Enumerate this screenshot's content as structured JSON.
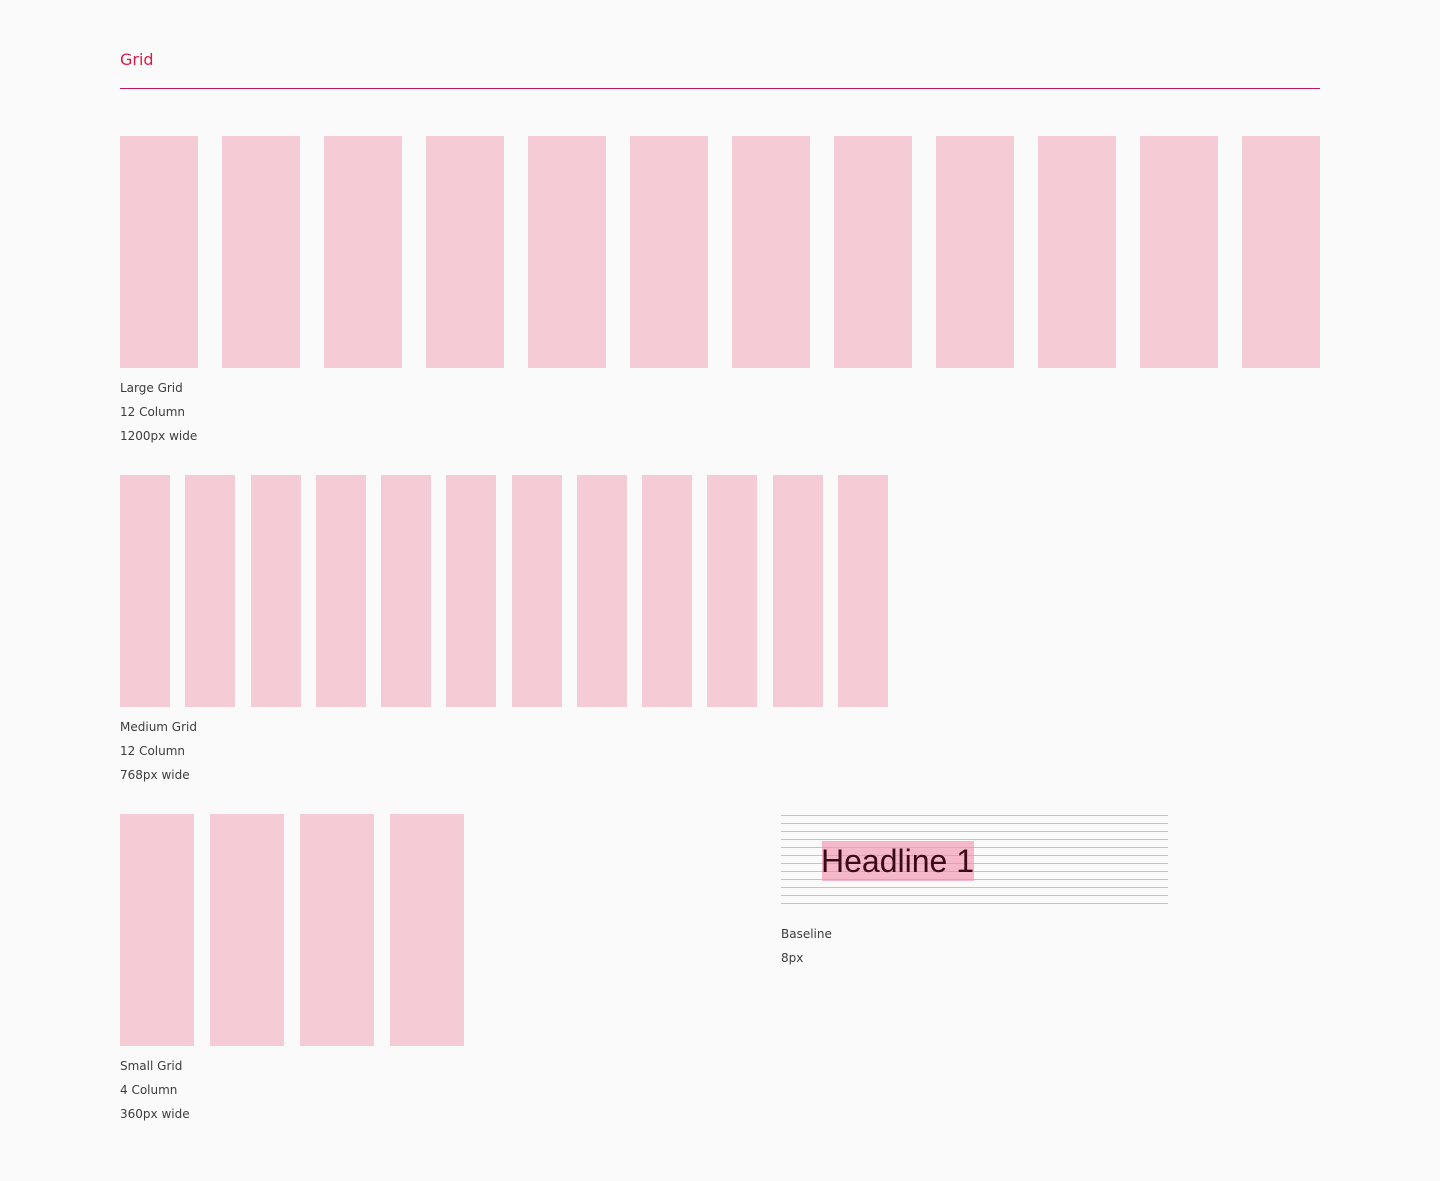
{
  "section_title": "Grid",
  "colors": {
    "accent": "#d81b49",
    "rule": "#c2185b",
    "column": "#f5ccd6",
    "baseline_line": "#efafc2",
    "headline_highlight": "#f08caa",
    "background": "#fafafa",
    "caption_text": "#3c3c3c"
  },
  "grids": {
    "large": {
      "columns": 12,
      "caption": [
        "Large Grid",
        "12 Column",
        "1200px wide"
      ]
    },
    "medium": {
      "columns": 12,
      "caption": [
        "Medium Grid",
        "12 Column",
        "768px wide"
      ]
    },
    "small": {
      "columns": 4,
      "caption": [
        "Small Grid",
        "4 Column",
        "360px wide"
      ]
    }
  },
  "baseline": {
    "headline": "Headline 1",
    "caption": [
      "Baseline",
      "8px"
    ]
  }
}
